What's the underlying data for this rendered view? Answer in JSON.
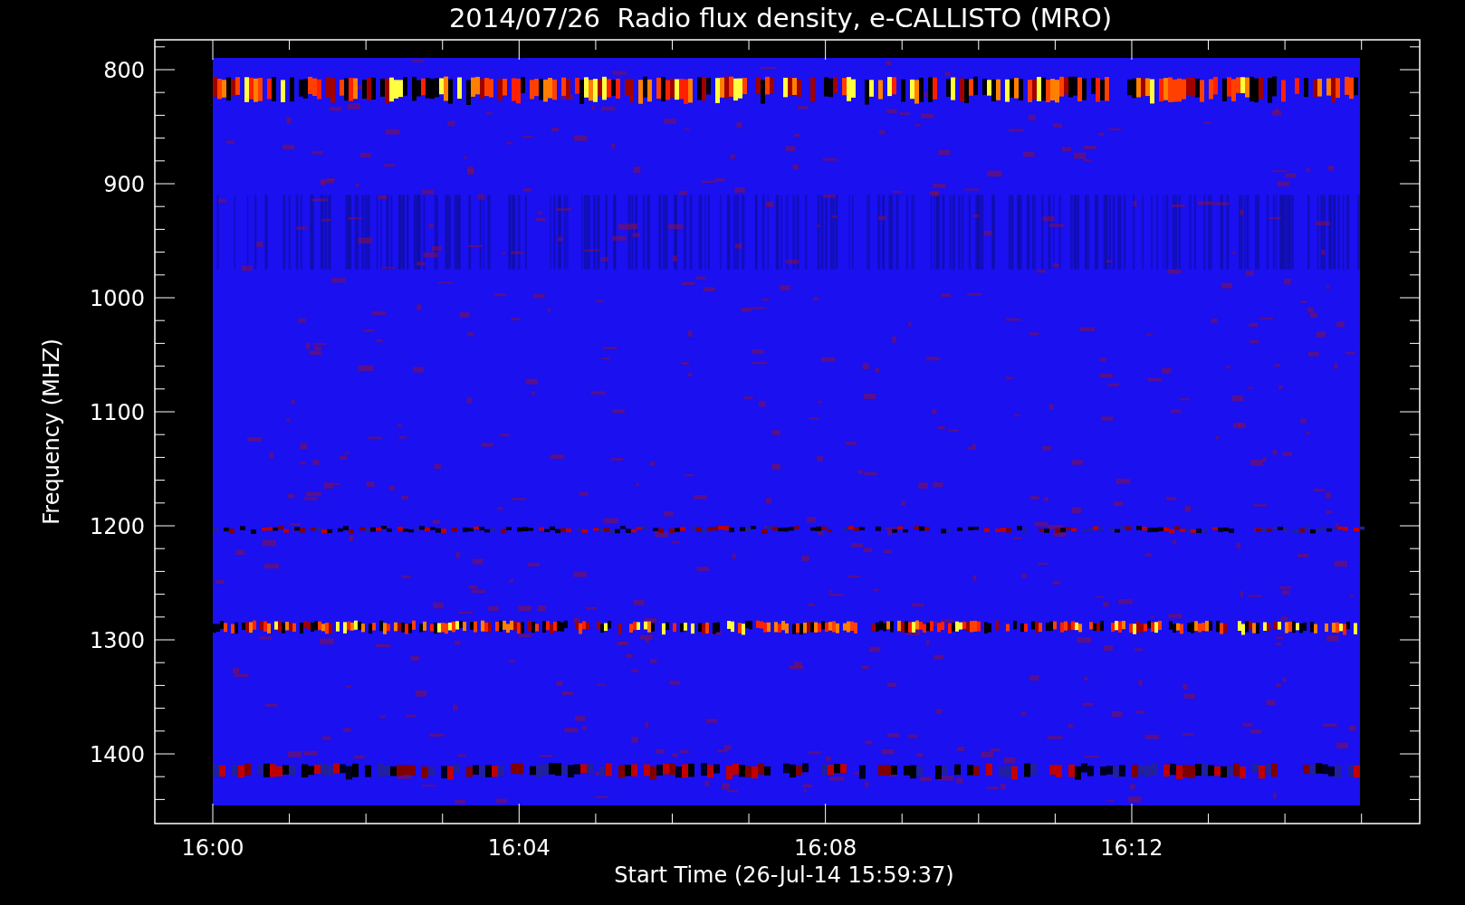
{
  "title": "2014/07/26  Radio flux density, e-CALLISTO (MRO)",
  "y_axis": {
    "label": "Frequency (MHZ)",
    "tick_labels": [
      "800",
      "900",
      "1000",
      "1100",
      "1200",
      "1300",
      "1400"
    ]
  },
  "x_axis": {
    "label": "Start Time (26-Jul-14 15:59:37)",
    "tick_labels": [
      "16:00",
      "16:04",
      "16:08",
      "16:12"
    ]
  }
}
